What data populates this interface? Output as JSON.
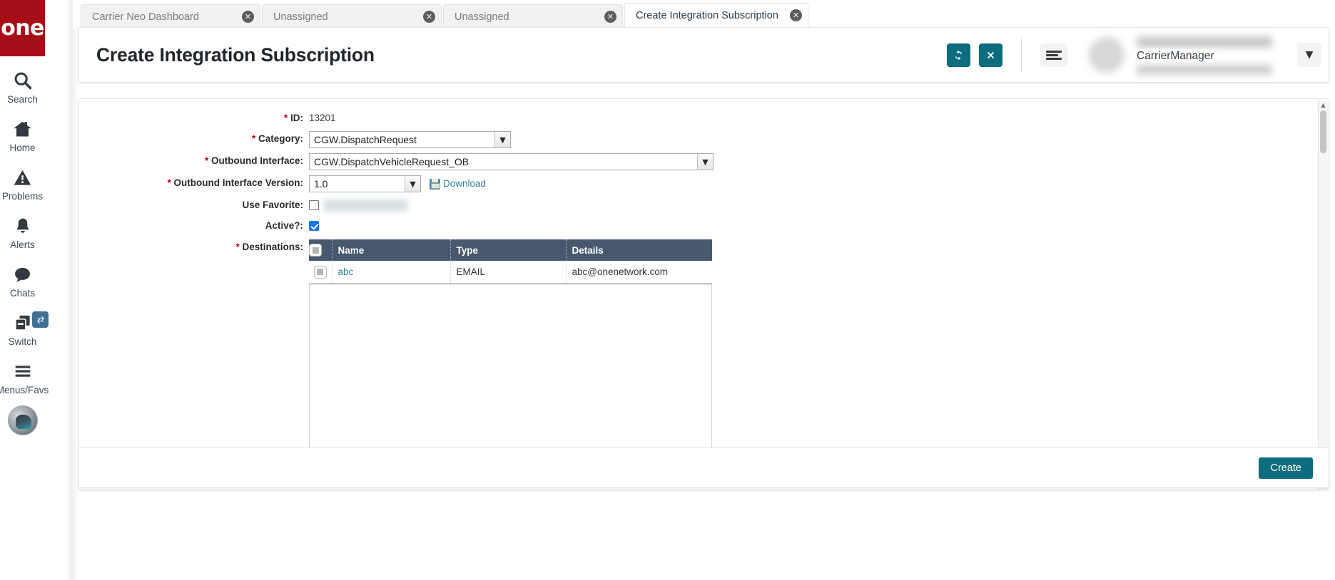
{
  "brand": {
    "logo_text": "one"
  },
  "sidebar": {
    "items": [
      {
        "label": "Search",
        "icon": "search-icon"
      },
      {
        "label": "Home",
        "icon": "home-icon"
      },
      {
        "label": "Problems",
        "icon": "warning-triangle-icon"
      },
      {
        "label": "Alerts",
        "icon": "bell-icon"
      },
      {
        "label": "Chats",
        "icon": "chat-bubble-icon"
      },
      {
        "label": "Switch",
        "icon": "switch-windows-icon",
        "badge_icon": "swap-arrows-icon"
      },
      {
        "label": "Menus/Favs",
        "icon": "hamburger-icon"
      }
    ]
  },
  "tabs": [
    {
      "label": "Carrier Neo Dashboard",
      "active": false,
      "close": "✕"
    },
    {
      "label": "Unassigned",
      "active": false,
      "close": "✕"
    },
    {
      "label": "Unassigned",
      "active": false,
      "close": "✕"
    },
    {
      "label": "Create Integration Subscription",
      "active": true,
      "close": "✕"
    }
  ],
  "header": {
    "title": "Create Integration Subscription",
    "refresh_icon": "⟳",
    "close_icon": "✕",
    "menu_icon": "hamburger-icon",
    "user_name": "CarrierManager",
    "caret_icon": "▼",
    "accent_color": "#0d6c7e"
  },
  "form": {
    "fields": [
      {
        "label": "ID:",
        "required": true,
        "type": "text",
        "value": "13201"
      },
      {
        "label": "Category:",
        "required": true,
        "type": "select",
        "value": "CGW.DispatchRequest"
      },
      {
        "label": "Outbound Interface:",
        "required": true,
        "type": "select",
        "value": "CGW.DispatchVehicleRequest_OB"
      },
      {
        "label": "Outbound Interface Version:",
        "required": true,
        "type": "select",
        "value": "1.0",
        "link_label": "Download",
        "link_icon": "save-floppy-icon"
      },
      {
        "label": "Use Favorite:",
        "required": false,
        "type": "checkbox",
        "checked": false
      },
      {
        "label": "Active?:",
        "required": false,
        "type": "checkbox",
        "checked": true
      },
      {
        "label": "Destinations:",
        "required": true,
        "type": "table"
      }
    ],
    "destinations_table": {
      "columns": [
        "",
        "Name",
        "Type",
        "Details"
      ],
      "rows": [
        {
          "name": "abc",
          "type": "EMAIL",
          "details": "abc@onenetwork.com"
        }
      ]
    }
  },
  "footer": {
    "create_label": "Create"
  },
  "colors": {
    "brand_red": "#a60f17",
    "accent_teal": "#0d6c7e",
    "table_header": "#48596e",
    "link": "#2f7d93",
    "required_star": "#b20000"
  }
}
